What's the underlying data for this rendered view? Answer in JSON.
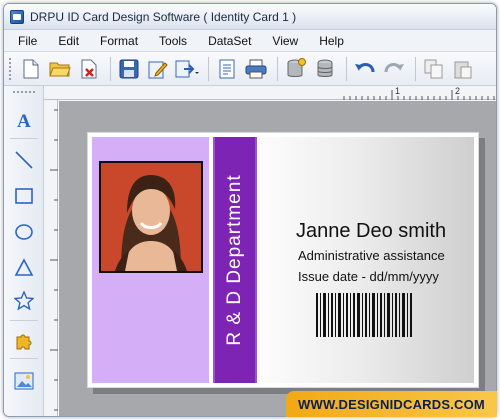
{
  "window": {
    "title": "DRPU ID Card Design Software ( Identity Card 1 )"
  },
  "menu": [
    "File",
    "Edit",
    "Format",
    "Tools",
    "DataSet",
    "View",
    "Help"
  ],
  "toolbar_icons": [
    "new-document-icon",
    "open-folder-icon",
    "delete-icon",
    "save-icon",
    "edit-icon",
    "export-icon",
    "properties-icon",
    "print-icon",
    "database-add-icon",
    "database-icon",
    "undo-icon",
    "redo-icon",
    "copy-icon",
    "paste-icon"
  ],
  "left_tools": [
    "text-icon",
    "line-icon",
    "rectangle-icon",
    "ellipse-icon",
    "triangle-icon",
    "star-icon",
    "puzzle-icon",
    "image-icon"
  ],
  "ruler": {
    "top_marks": [
      "1",
      "2"
    ]
  },
  "card": {
    "department": "R & D Department",
    "name": "Janne Deo smith",
    "role": "Administrative assistance",
    "issue_date": "Issue date - dd/mm/yyyy",
    "colors": {
      "panel": "#d5aef8",
      "dept_bar": "#7e24b5"
    }
  },
  "brand": {
    "text": "WWW.DESIGNIDCARDS.COM"
  }
}
